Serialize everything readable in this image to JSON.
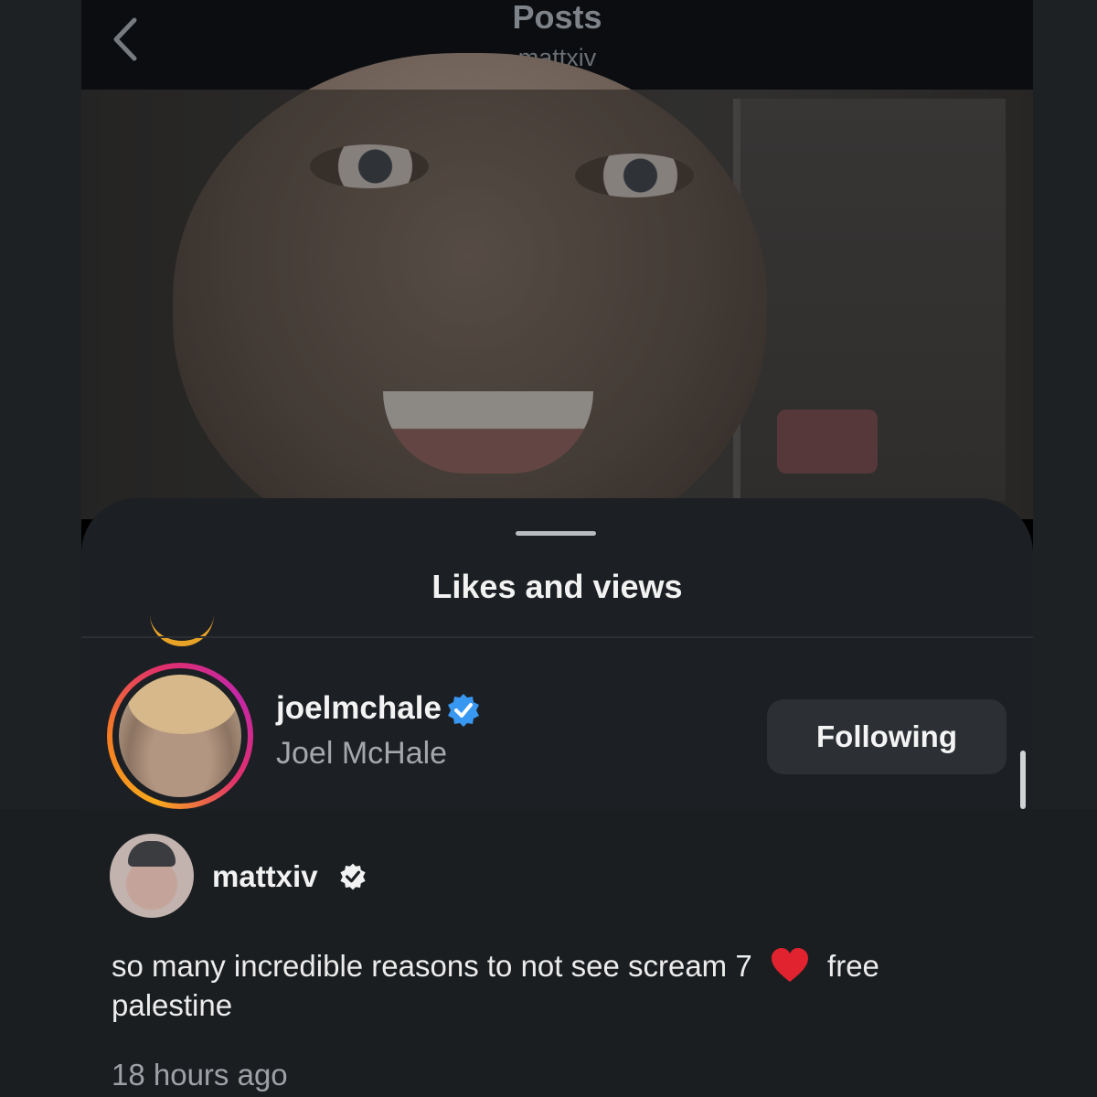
{
  "header": {
    "title": "Posts",
    "subtitle": "mattxiv"
  },
  "sheet": {
    "title": "Likes and views"
  },
  "liker": {
    "username": "joelmchale",
    "full_name": "Joel McHale",
    "verified": true,
    "follow_button_label": "Following"
  },
  "caption": {
    "username": "mattxiv",
    "verified": true,
    "text_before_heart": "so many incredible reasons to not see scream 7",
    "text_after_heart": "free palestine",
    "timestamp": "18 hours ago"
  },
  "colors": {
    "verified_blue": "#3897f0",
    "heart_red": "#e0232e",
    "story_ring": [
      "#f8a91c",
      "#e1306c",
      "#c427a8"
    ]
  },
  "icons": [
    "back-chevron-icon",
    "verified-badge-icon",
    "heart-emoji-icon"
  ]
}
